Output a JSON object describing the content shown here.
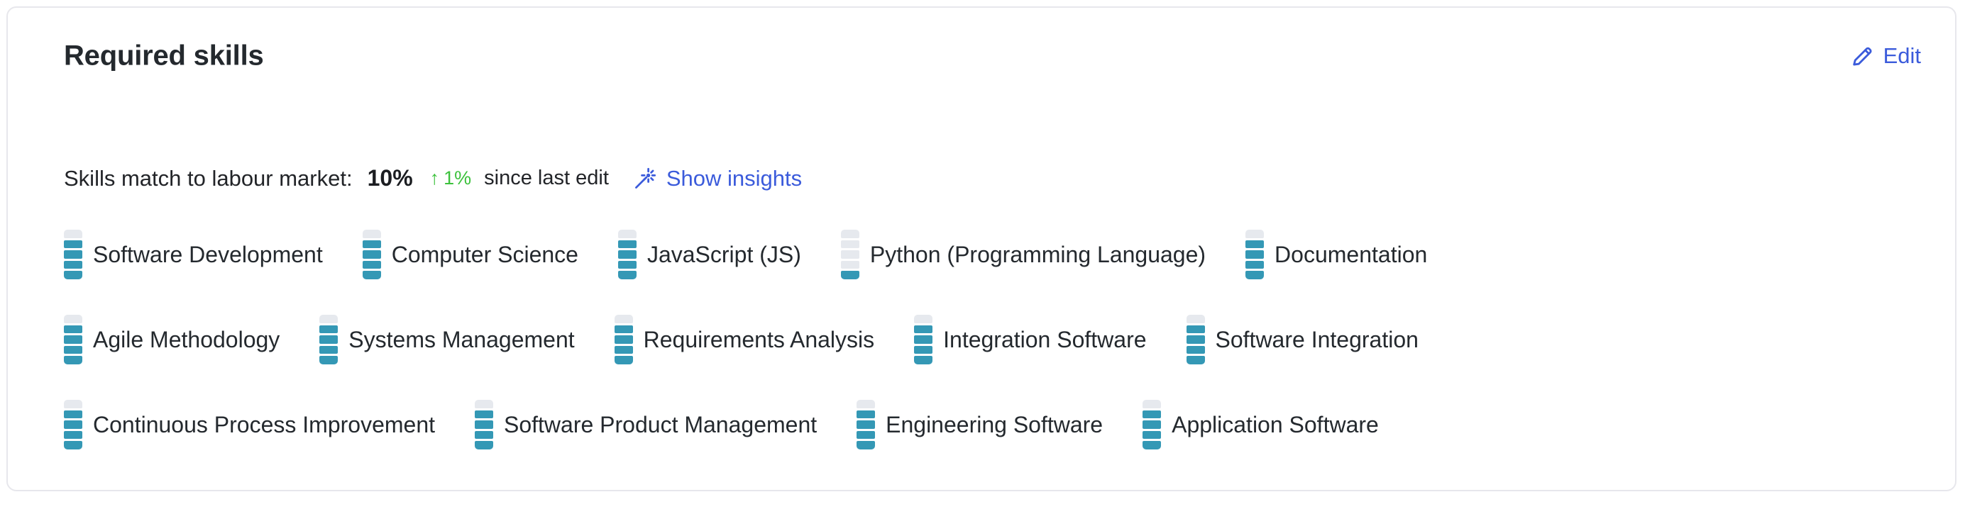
{
  "card": {
    "title": "Required skills",
    "edit": {
      "label": "Edit",
      "icon": "pencil-icon",
      "color": "#3b5bdb"
    }
  },
  "match": {
    "label": "Skills match to labour market:",
    "value": "10%",
    "delta_arrow": "↑",
    "delta_value": "1%",
    "delta_color": "#3cc13c",
    "since_text": "since last edit",
    "insights": {
      "label": "Show insights",
      "icon": "magic-wand-icon",
      "color": "#3b5bdb"
    }
  },
  "skills_meta": {
    "levels_total": 5,
    "filled_color": "#3498b5",
    "empty_color": "#e6e9ee",
    "icon": "skill-level-indicator-icon"
  },
  "skills_rows": [
    [
      {
        "name": "Software Development",
        "level": 4
      },
      {
        "name": "Computer Science",
        "level": 4
      },
      {
        "name": "JavaScript (JS)",
        "level": 4
      },
      {
        "name": "Python (Programming Language)",
        "level": 1
      },
      {
        "name": "Documentation",
        "level": 4
      }
    ],
    [
      {
        "name": "Agile Methodology",
        "level": 4
      },
      {
        "name": "Systems Management",
        "level": 4
      },
      {
        "name": "Requirements Analysis",
        "level": 4
      },
      {
        "name": "Integration Software",
        "level": 4
      },
      {
        "name": "Software Integration",
        "level": 4
      }
    ],
    [
      {
        "name": "Continuous Process Improvement",
        "level": 4
      },
      {
        "name": "Software Product Management",
        "level": 4
      },
      {
        "name": "Engineering Software",
        "level": 4
      },
      {
        "name": "Application Software",
        "level": 4
      }
    ]
  ]
}
